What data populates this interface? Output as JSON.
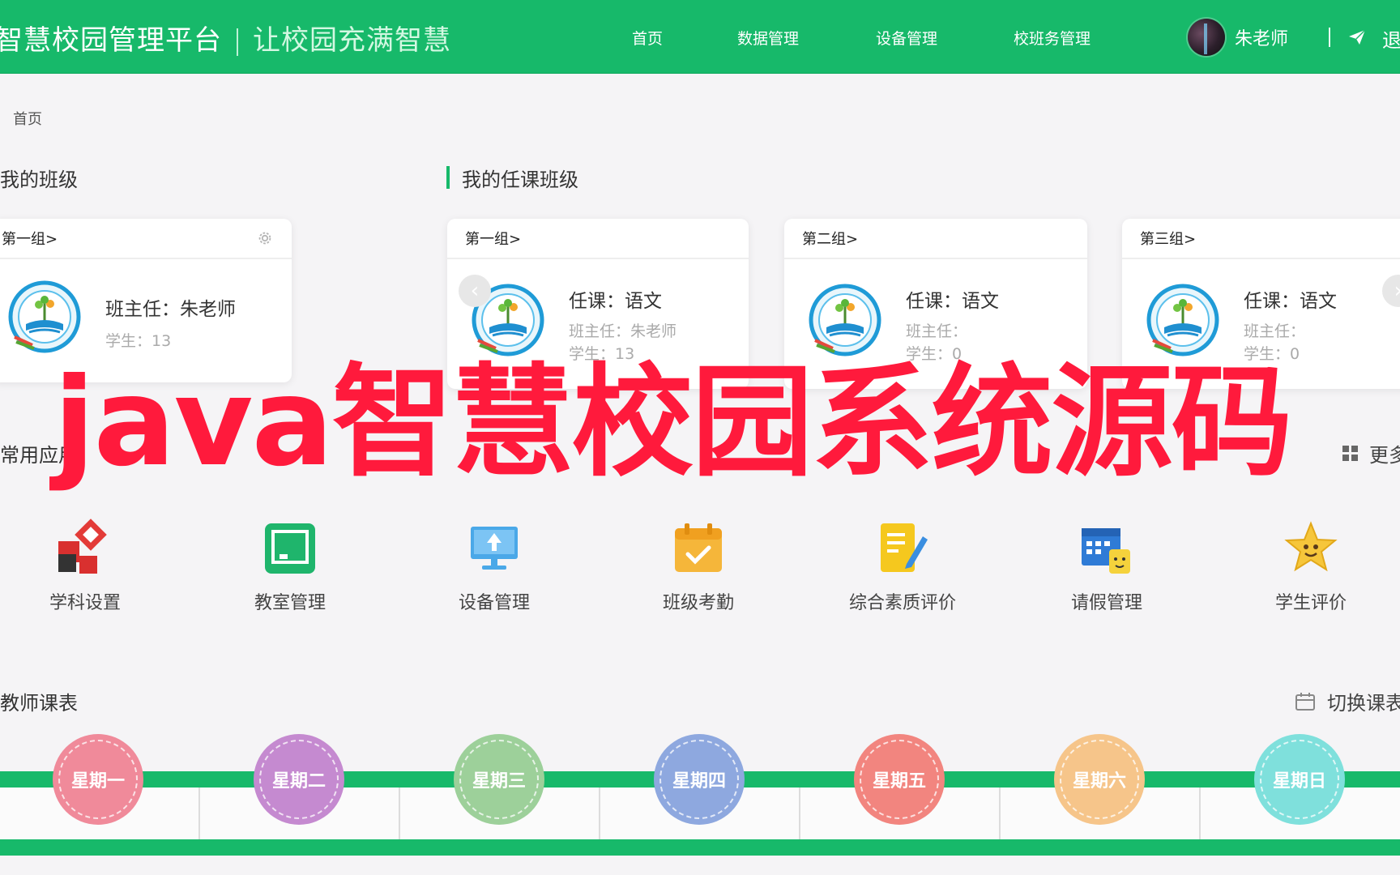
{
  "header": {
    "app_title": "智慧校园管理平台",
    "slogan": "让校园充满智慧",
    "nav": [
      "首页",
      "数据管理",
      "设备管理",
      "校班务管理"
    ],
    "user_name": "朱老师",
    "logout": "退"
  },
  "breadcrumb": "首页",
  "my_class": {
    "title": "我的班级",
    "card": {
      "group": "第一组>",
      "head_teacher": "班主任：朱老师",
      "students": "学生：13"
    }
  },
  "teaching_classes": {
    "title": "我的任课班级",
    "cards": [
      {
        "group": "第一组>",
        "subject": "任课：语文",
        "head_teacher": "班主任：朱老师",
        "students": "学生：13"
      },
      {
        "group": "第二组>",
        "subject": "任课：语文",
        "head_teacher": "班主任：",
        "students": "学生：0"
      },
      {
        "group": "第三组>",
        "subject": "任课：语文",
        "head_teacher": "班主任：",
        "students": "学生：0"
      }
    ]
  },
  "common_apps": {
    "title": "常用应用",
    "more": "更多",
    "items": [
      "学科设置",
      "教室管理",
      "设备管理",
      "班级考勤",
      "综合素质评价",
      "请假管理",
      "学生评价"
    ]
  },
  "timetable": {
    "title": "教师课表",
    "switch": "切换课表",
    "days": [
      "星期一",
      "星期二",
      "星期三",
      "星期四",
      "星期五",
      "星期六",
      "星期日"
    ],
    "day_colors": [
      "#f08a9a",
      "#c58ad0",
      "#9dd09a",
      "#8ea8df",
      "#f2857f",
      "#f6c58a",
      "#7fe0dc"
    ]
  },
  "watermark": "java智慧校园系统源码",
  "colors": {
    "brand_green": "#17b96a",
    "watermark_red": "#ff1a3c"
  }
}
